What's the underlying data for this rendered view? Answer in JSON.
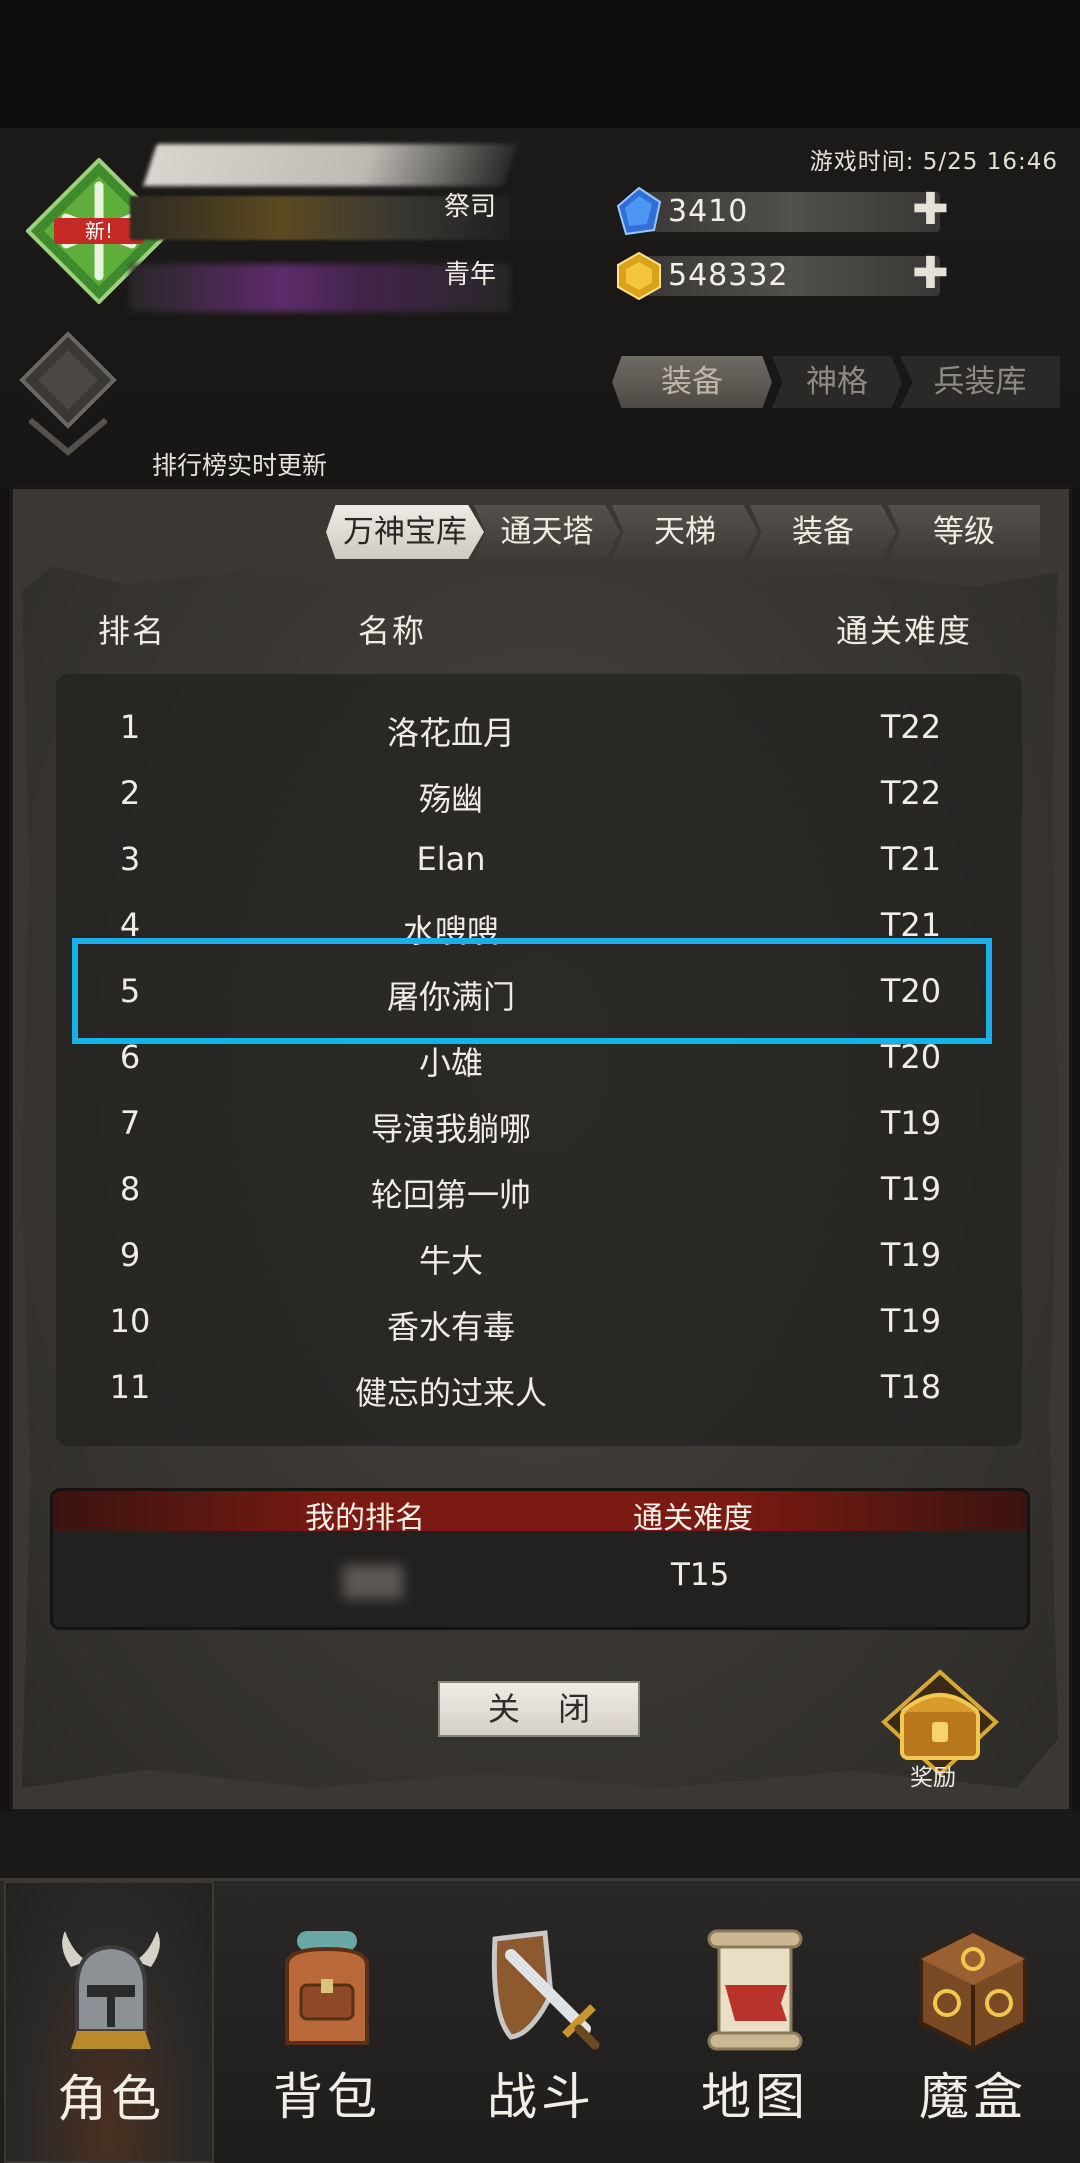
{
  "header": {
    "game_time": "游戏时间: 5/25 16:46",
    "badge_text": "新!",
    "class_label": "祭司",
    "age_label": "青年",
    "gems": "3410",
    "gold": "548332",
    "realtime_note": "排行榜实时更新",
    "top_tabs": [
      "装备",
      "神格",
      "兵装库"
    ]
  },
  "ranking": {
    "tabs": [
      "万神宝库",
      "通天塔",
      "天梯",
      "装备",
      "等级"
    ],
    "active_tab": "万神宝库",
    "headers": {
      "rank": "排名",
      "name": "名称",
      "difficulty": "通关难度"
    },
    "rows": [
      {
        "rank": "1",
        "name": "洛花血月",
        "difficulty": "T22"
      },
      {
        "rank": "2",
        "name": "殇幽",
        "difficulty": "T22"
      },
      {
        "rank": "3",
        "name": "Elan",
        "difficulty": "T21"
      },
      {
        "rank": "4",
        "name": "水嗖嗖",
        "difficulty": "T21"
      },
      {
        "rank": "5",
        "name": "屠你满门",
        "difficulty": "T20"
      },
      {
        "rank": "6",
        "name": "小雄",
        "difficulty": "T20"
      },
      {
        "rank": "7",
        "name": "导演我躺哪",
        "difficulty": "T19"
      },
      {
        "rank": "8",
        "name": "轮回第一帅",
        "difficulty": "T19"
      },
      {
        "rank": "9",
        "name": "牛大",
        "difficulty": "T19"
      },
      {
        "rank": "10",
        "name": "香水有毒",
        "difficulty": "T19"
      },
      {
        "rank": "11",
        "name": "健忘的过来人",
        "difficulty": "T18"
      }
    ],
    "my_rank_label": "我的排名",
    "my_difficulty_label": "通关难度",
    "my_difficulty": "T15",
    "close_label": "关 闭",
    "reward_label": "奖励"
  },
  "nav": {
    "items": [
      {
        "label": "角色",
        "icon": "helmet-icon"
      },
      {
        "label": "背包",
        "icon": "backpack-icon"
      },
      {
        "label": "战斗",
        "icon": "sword-shield-icon"
      },
      {
        "label": "地图",
        "icon": "scroll-map-icon"
      },
      {
        "label": "魔盒",
        "icon": "magic-box-icon"
      }
    ],
    "active": "角色"
  },
  "colors": {
    "highlight": "#1ab1e8",
    "my_rank_header": "#7a1a12"
  }
}
